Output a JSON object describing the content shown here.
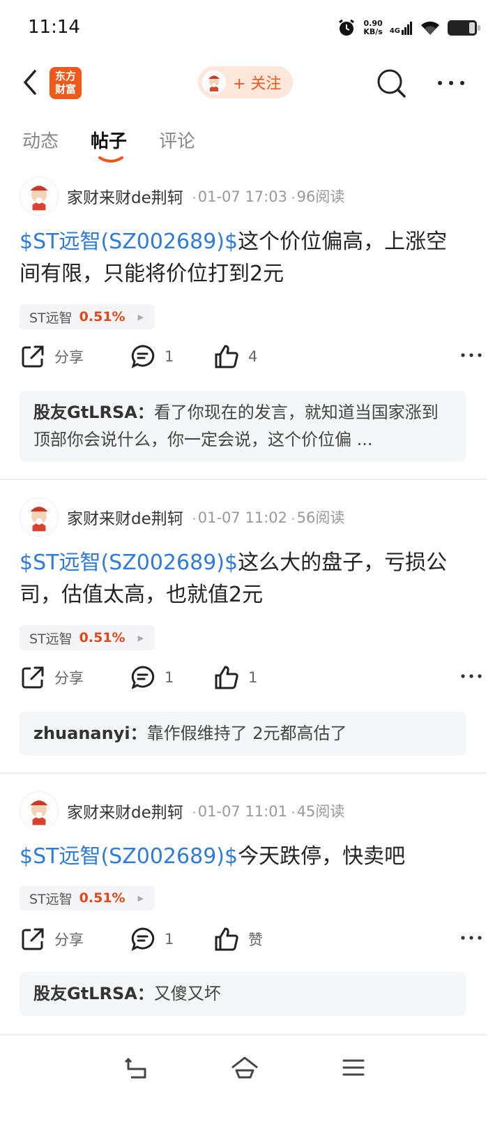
{
  "status_bar": {
    "time": "11:14",
    "net_speed": "0.90",
    "net_unit": "KB/s",
    "signal_label": "4G"
  },
  "header": {
    "logo_line1": "东方",
    "logo_line2": "财富",
    "follow_label": "+ 关注"
  },
  "tabs": [
    {
      "label": "动态",
      "active": false
    },
    {
      "label": "帖子",
      "active": true
    },
    {
      "label": "评论",
      "active": false
    }
  ],
  "posts": [
    {
      "author": "家财来财de荆轲",
      "time": "01-07 17:03",
      "reads": "96阅读",
      "stock_link": "$ST远智(SZ002689)$",
      "text": "这个价位偏高，上涨空间有限，只能将价位打到2元",
      "tag_name": "ST远智",
      "tag_change": "0.51%",
      "share_label": "分享",
      "comment_count": "1",
      "like_count": "4",
      "reply_name": "股友GtLRSA：",
      "reply_text": "看了你现在的发言，就知道当国家涨到顶部你会说什么，你一定会说，这个价位偏 ..."
    },
    {
      "author": "家财来财de荆轲",
      "time": "01-07 11:02",
      "reads": "56阅读",
      "stock_link": "$ST远智(SZ002689)$",
      "text": "这么大的盘子，亏损公司，估值太高，也就值2元",
      "tag_name": "ST远智",
      "tag_change": "0.51%",
      "share_label": "分享",
      "comment_count": "1",
      "like_count": "1",
      "reply_name": "zhuananyi：",
      "reply_text": "靠作假维持了 2元都高估了"
    },
    {
      "author": "家财来财de荆轲",
      "time": "01-07 11:01",
      "reads": "45阅读",
      "stock_link": "$ST远智(SZ002689)$",
      "text": "今天跌停，快卖吧",
      "tag_name": "ST远智",
      "tag_change": "0.51%",
      "share_label": "分享",
      "comment_count": "1",
      "like_count": "赞",
      "reply_name": "股友GtLRSA：",
      "reply_text": "又傻又坏"
    }
  ],
  "colors": {
    "brand": "#ef5a1c",
    "link": "#2f7bd9",
    "change_up": "#e2471a"
  },
  "icons": {
    "back": "back-arrow-icon",
    "search": "search-icon",
    "more": "more-dots-icon",
    "share": "share-icon",
    "comment": "comment-bubble-icon",
    "like": "thumbs-up-icon",
    "nav_back": "nav-back-icon",
    "nav_home": "nav-home-icon",
    "nav_menu": "nav-menu-icon"
  }
}
